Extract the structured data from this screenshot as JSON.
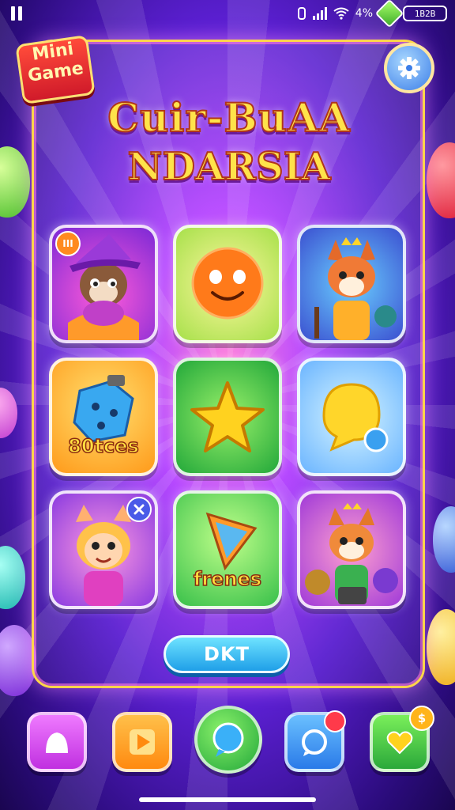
{
  "status_bar": {
    "battery_percent": "4%",
    "battery_box_text": "1B2B"
  },
  "badge": {
    "line1": "Mini",
    "line2": "Game"
  },
  "title": {
    "line1": "Cuir-BuAA",
    "line2": "NDARSIA"
  },
  "tiles": [
    {
      "name": "wizard-cat",
      "corner_badge": "III"
    },
    {
      "name": "smiley-sun"
    },
    {
      "name": "fox-king"
    },
    {
      "name": "dice",
      "label": "80tces"
    },
    {
      "name": "star"
    },
    {
      "name": "chat-bubble"
    },
    {
      "name": "girl-cat"
    },
    {
      "name": "pizza",
      "label": "frenes"
    },
    {
      "name": "fox-gears"
    }
  ],
  "play_button": {
    "label": "DKT"
  },
  "bottom_nav": [
    {
      "icon": "home-icon",
      "color": "#d64df0"
    },
    {
      "icon": "play-icon",
      "color": "#ff9a1f"
    },
    {
      "icon": "globe-chat-icon",
      "color": "#2fb84a"
    },
    {
      "icon": "message-icon",
      "color": "#2a8cf0"
    },
    {
      "icon": "heart-chat-icon",
      "color": "#35c23c",
      "badge": "$"
    }
  ],
  "colors": {
    "accent_gold": "#ffd54a",
    "panel_border": "#ffd54a",
    "play_button": "#1f9fe8"
  }
}
